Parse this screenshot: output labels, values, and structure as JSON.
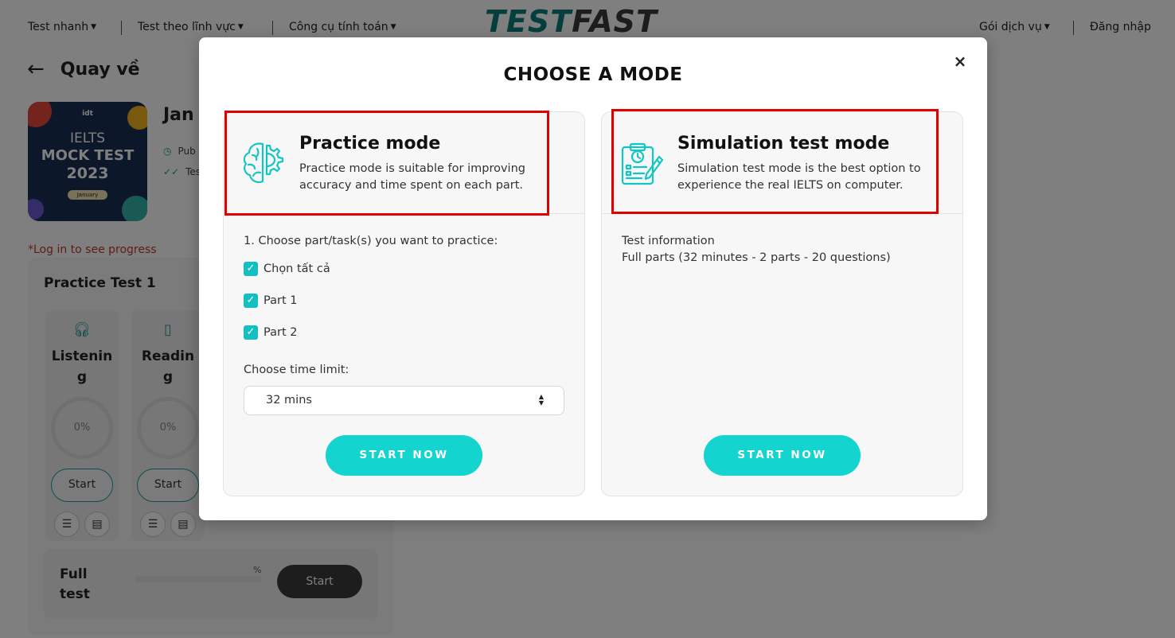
{
  "nav": {
    "test_fast": "Test nhanh",
    "by_field": "Test theo lĩnh vực",
    "calc_tools": "Công cụ tính toán",
    "logo_part1": "TEST",
    "logo_part2": "FAST",
    "service_plans": "Gói dịch vụ",
    "login": "Đăng nhập"
  },
  "page": {
    "back_label": "Quay về",
    "test_title_partial": "Jan",
    "meta_published_partial": "Pub",
    "meta_tests_partial": "Tes",
    "thumb": {
      "org": "idt",
      "line1": "IELTS",
      "line2": "MOCK TEST",
      "line3": "2023",
      "badge": "January"
    },
    "login_note": "*Log in to see progress",
    "practice_title": "Practice Test 1",
    "skills": [
      {
        "name_line1": "Listenin",
        "name_line2": "g",
        "progress": "0%",
        "start": "Start"
      },
      {
        "name_line1": "Readin",
        "name_line2": "g",
        "progress": "0%",
        "start": "Start"
      }
    ],
    "full_test": {
      "label_line1": "Full",
      "label_line2": "test",
      "percent_sign": "%",
      "start": "Start"
    }
  },
  "modal": {
    "title": "CHOOSE A MODE",
    "close_icon": "×",
    "practice": {
      "name": "Practice mode",
      "description": "Practice mode is suitable for improving accuracy and time spent on each part.",
      "choose_label": "1. Choose part/task(s) you want to practice:",
      "options": [
        {
          "label": "Chọn tất cả",
          "checked": true
        },
        {
          "label": "Part 1",
          "checked": true
        },
        {
          "label": "Part 2",
          "checked": true
        }
      ],
      "time_label": "Choose time limit:",
      "time_value": "32 mins",
      "start": "START NOW"
    },
    "simulation": {
      "name": "Simulation test mode",
      "description": "Simulation test mode is the best option to experience the real IELTS on computer.",
      "info_label": "Test information",
      "info_value": "Full parts (32 minutes - 2 parts - 20 questions)",
      "start": "START NOW"
    }
  },
  "colors": {
    "accent": "#13d4cf",
    "checkbox": "#13bfc0",
    "highlight": "#e10000",
    "logo_teal": "#0a7f7a"
  }
}
